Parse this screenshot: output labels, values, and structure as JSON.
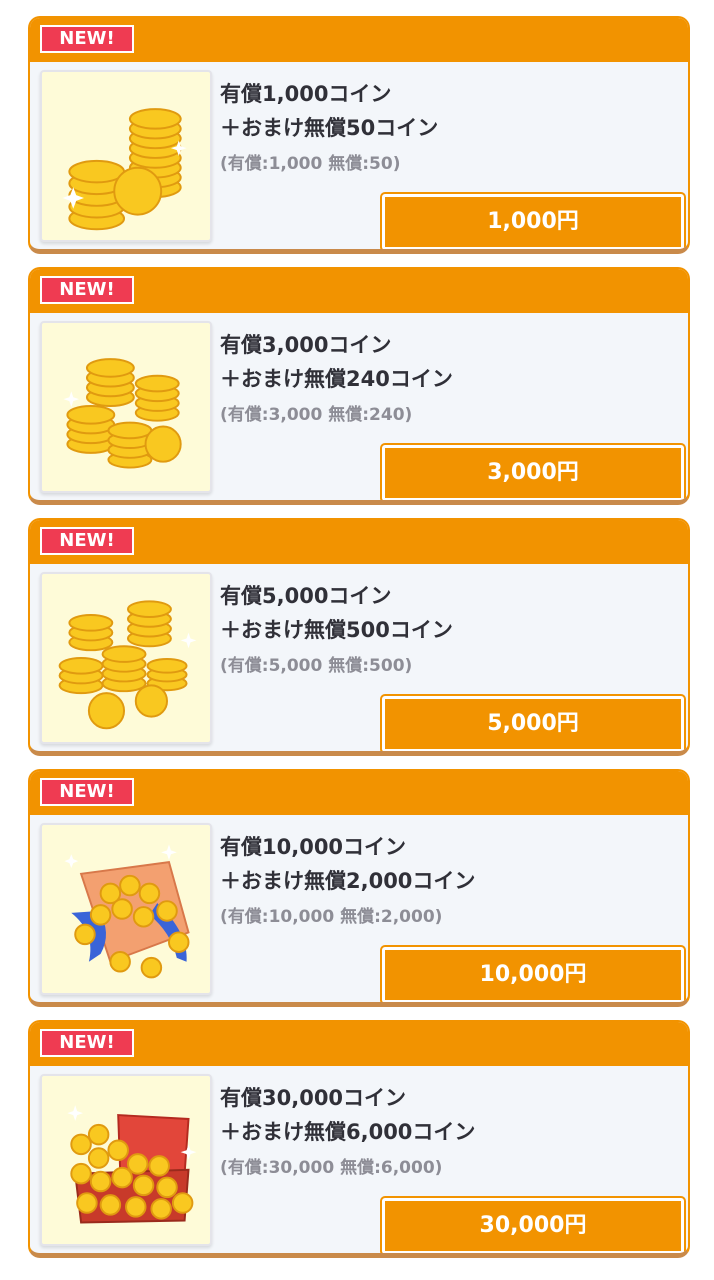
{
  "badge_label": "NEW!",
  "colors": {
    "accent": "#f29300",
    "badge": "#ef3b52",
    "card_bg": "#f3f6fa",
    "thumb_bg": "#fefbd8",
    "coin": "#f9c820"
  },
  "products": [
    {
      "icon": "small-coin-stack-icon",
      "title": "有償1,000コイン",
      "bonus": "＋おまけ無償50コイン",
      "detail": "(有償:1,000 無償:50)",
      "price": "1,000円"
    },
    {
      "icon": "coin-stacks-icon",
      "title": "有償3,000コイン",
      "bonus": "＋おまけ無償240コイン",
      "detail": "(有償:3,000 無償:240)",
      "price": "3,000円"
    },
    {
      "icon": "coin-piles-icon",
      "title": "有償5,000コイン",
      "bonus": "＋おまけ無償500コイン",
      "detail": "(有償:5,000 無償:500)",
      "price": "5,000円"
    },
    {
      "icon": "coin-bag-icon",
      "title": "有償10,000コイン",
      "bonus": "＋おまけ無償2,000コイン",
      "detail": "(有償:10,000 無償:2,000)",
      "price": "10,000円"
    },
    {
      "icon": "treasure-chest-icon",
      "title": "有償30,000コイン",
      "bonus": "＋おまけ無償6,000コイン",
      "detail": "(有償:30,000 無償:6,000)",
      "price": "30,000円"
    }
  ]
}
